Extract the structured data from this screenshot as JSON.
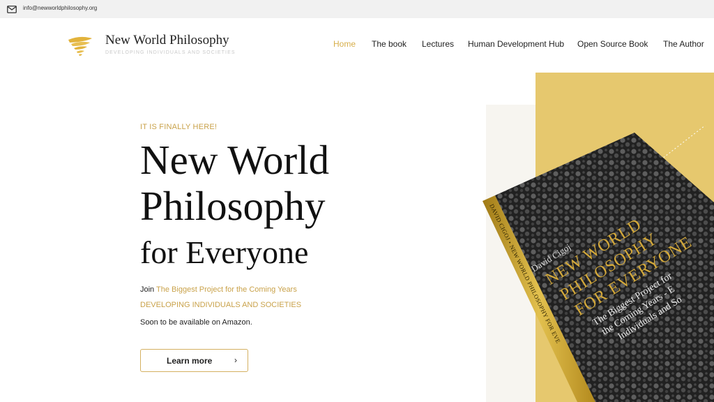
{
  "topbar": {
    "email": "info@newworldphilosophy.org",
    "icon": "mail-icon"
  },
  "brand": {
    "name": "New World Philosophy",
    "tagline": "DEVELOPING INDIVIDUALS AND SOCIETIES"
  },
  "nav": [
    {
      "label": "Home",
      "active": true
    },
    {
      "label": "The book",
      "active": false
    },
    {
      "label": "Lectures",
      "active": false
    },
    {
      "label": "Human Development Hub",
      "active": false
    },
    {
      "label": "Open Source Book",
      "active": false
    },
    {
      "label": "The Author",
      "active": false
    }
  ],
  "hero": {
    "eyebrow": "IT IS FINALLY HERE!",
    "title_line1": "New World",
    "title_line2": "Philosophy",
    "title_line3": "for Everyone",
    "join_prefix": "Join",
    "join_link": "The Biggest Project for the Coming Years",
    "tagline": "DEVELOPING INDIVIDUALS AND SOCIETIES",
    "availability": "Soon to be available on Amazon.",
    "cta_label": "Learn more",
    "cta_chevron": "›"
  },
  "book": {
    "author": "David Cigoj",
    "title_line1": "NEW WORLD",
    "title_line2": "PHILOSOPHY",
    "title_line3": "FOR EVERYONE",
    "subtitle_line1": "The Biggest Project for",
    "subtitle_line2": "the Coming Years - E",
    "subtitle_line3": "Individuals and So",
    "spine_text": "DAVID CIGOJ • NEW WORLD PHILOSOPHY FOR EVE"
  },
  "colors": {
    "accent": "#d7ae4a",
    "gold_panel": "#e6c86e",
    "topbar": "#f1f1f1"
  }
}
